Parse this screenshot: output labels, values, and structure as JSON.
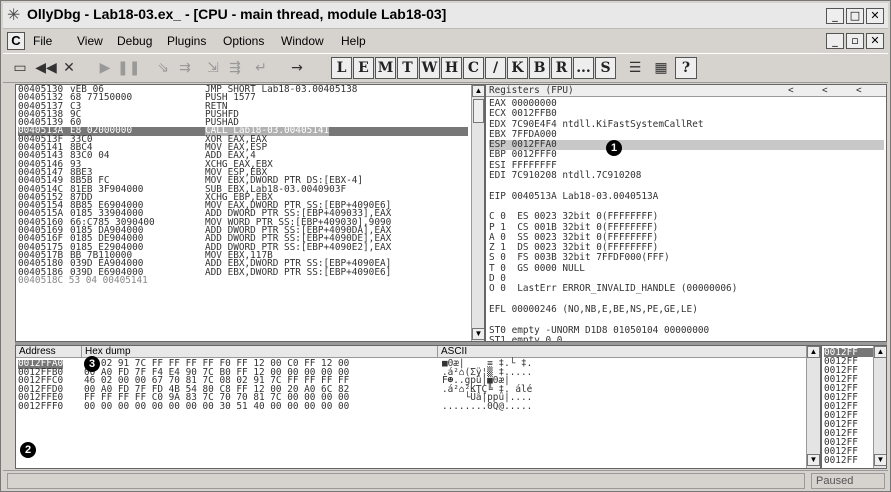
{
  "window": {
    "title": "OllyDbg - Lab18-03.ex_ - [CPU - main thread, module Lab18-03]"
  },
  "titlebar_buttons": [
    "_",
    "□",
    "✕"
  ],
  "mdi_buttons": [
    "_",
    "▫",
    "✕"
  ],
  "menu": [
    "C",
    "File",
    "View",
    "Debug",
    "Plugins",
    "Options",
    "Window",
    "Help"
  ],
  "toolbar": {
    "icons": [
      "open-icon",
      "rewind-icon",
      "close-icon",
      "run-icon",
      "pause-icon",
      "step-into-icon",
      "step-over-icon",
      "trace-into-icon",
      "trace-over-icon",
      "execute-till-return-icon",
      "go-to-icon"
    ],
    "letters": [
      "L",
      "E",
      "M",
      "T",
      "W",
      "H",
      "C",
      "/",
      "K",
      "B",
      "R",
      "...",
      "S"
    ],
    "end_icons": [
      "list-icon",
      "grid-icon",
      "help-icon"
    ]
  },
  "disasm": {
    "rows": [
      [
        "00405130",
        "vEB 06",
        "JMP SHORT Lab18-03.00405138"
      ],
      [
        "00405132",
        "68 77150000",
        "PUSH 1577"
      ],
      [
        "00405137",
        "C3",
        "RETN"
      ],
      [
        "00405138",
        "9C",
        "PUSHFD"
      ],
      [
        "00405139",
        "60",
        "PUSHAD"
      ],
      [
        "0040513A",
        "E8 02000000",
        "CALL Lab18-03.00405141"
      ],
      [
        "0040513F",
        "33C0",
        "XOR EAX,EAX"
      ],
      [
        "00405141",
        "8BC4",
        "MOV EAX,ESP"
      ],
      [
        "00405143",
        "83C0 04",
        "ADD EAX,4"
      ],
      [
        "00405146",
        "93",
        "XCHG EAX,EBX"
      ],
      [
        "00405147",
        "8BE3",
        "MOV ESP,EBX"
      ],
      [
        "00405149",
        "8B5B FC",
        "MOV EBX,DWORD PTR DS:[EBX-4]"
      ],
      [
        "0040514C",
        "81EB 3F904000",
        "SUB EBX,Lab18-03.0040903F"
      ],
      [
        "00405152",
        "87DD",
        "XCHG EBP,EBX"
      ],
      [
        "00405154",
        "8B85 E6904000",
        "MOV EAX,DWORD PTR SS:[EBP+4090E6]"
      ],
      [
        "0040515A",
        "0185 33904000",
        "ADD DWORD PTR SS:[EBP+409033],EAX"
      ],
      [
        "00405160",
        "66:C785 3090400",
        "MOV WORD PTR SS:[EBP+409030],9090"
      ],
      [
        "00405169",
        "0185 DA904000",
        "ADD DWORD PTR SS:[EBP+4090DA],EAX"
      ],
      [
        "0040516F",
        "0185 DE904000",
        "ADD DWORD PTR SS:[EBP+4090DE],EAX"
      ],
      [
        "00405175",
        "0185 E2904000",
        "ADD DWORD PTR SS:[EBP+4090E2],EAX"
      ],
      [
        "0040517B",
        "BB 7B110000",
        "MOV EBX,117B"
      ],
      [
        "00405180",
        "039D EA904000",
        "ADD EBX,DWORD PTR SS:[EBP+4090EA]"
      ],
      [
        "00405186",
        "039D E6904000",
        "ADD EBX,DWORD PTR SS:[EBP+4090E6]"
      ]
    ],
    "partial_row": "0040518C 53 04 00405141"
  },
  "registers": {
    "title": "Registers (FPU)",
    "nav": [
      "<",
      "<",
      "<"
    ],
    "lines": [
      "EAX 00000000",
      "ECX 0012FFB0",
      "EDX 7C90E4F4 ntdll.KiFastSystemCallRet",
      "EBX 7FFDA000",
      "ESP 0012FFA0",
      "EBP 0012FFF0",
      "ESI FFFFFFFF",
      "EDI 7C910208 ntdll.7C910208",
      "",
      "EIP 0040513A Lab18-03.0040513A",
      "",
      "C 0  ES 0023 32bit 0(FFFFFFFF)",
      "P 1  CS 001B 32bit 0(FFFFFFFF)",
      "A 0  SS 0023 32bit 0(FFFFFFFF)",
      "Z 1  DS 0023 32bit 0(FFFFFFFF)",
      "S 0  FS 003B 32bit 7FFDF000(FFF)",
      "T 0  GS 0000 NULL",
      "D 0",
      "O 0  LastErr ERROR_INVALID_HANDLE (00000006)",
      "",
      "EFL 00000246 (NO,NB,E,BE,NS,PE,GE,LE)",
      "",
      "ST0 empty -UNORM D1D8 01050104 00000000",
      "ST1 empty 0.0"
    ]
  },
  "dump": {
    "headers": [
      "Address",
      "Hex dump",
      "ASCII"
    ],
    "rows": [
      [
        "0012FFA0",
        "00 02 91 7C FF FF FF FF F0 FF 12 00 C0 FF 12 00",
        "■Θæ|    ≡ ‡.└ ‡."
      ],
      [
        "0012FFB0",
        "00 A0 FD 7F F4 E4 90 7C B0 FF 12 00 00 00 00 00",
        ".á²⌂(Σÿ¦▒ ‡....."
      ],
      [
        "0012FFC0",
        "46 02 00 00 67 70 81 7C 08 02 91 7C FF FF FF FF",
        "F☻..gpü|■Θæ|    "
      ],
      [
        "0012FFD0",
        "00 A0 FD 7F FD 4B 54 80 C8 FF 12 00 20 A0 6C 82",
        ".á²⌂²KTÇ╚ ‡. álé"
      ],
      [
        "0012FFE0",
        "FF FF FF FF C0 9A 83 7C 70 70 81 7C 00 00 00 00",
        "    └Üâ|ppü|...."
      ],
      [
        "0012FFF0",
        "00 00 00 00 00 00 00 00 30 51 40 00 00 00 00 00",
        "........0Q@....."
      ]
    ]
  },
  "stack": {
    "rows": [
      "0012FF",
      "0012FF",
      "0012FF",
      "0012FF",
      "0012FF",
      "0012FF",
      "0012FF",
      "0012FF",
      "0012FF",
      "0012FF",
      "0012FF",
      "0012FF",
      "0012FF"
    ]
  },
  "annotations": {
    "one": "1",
    "two": "2",
    "three": "3"
  },
  "status": {
    "text": "Paused"
  }
}
